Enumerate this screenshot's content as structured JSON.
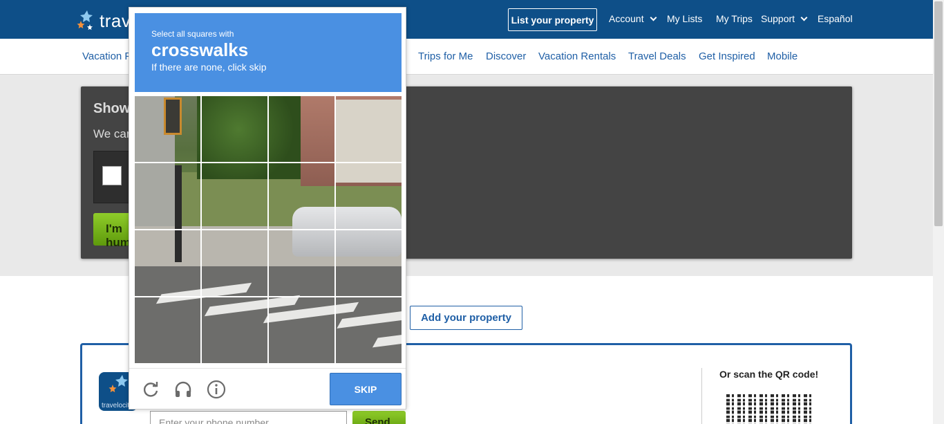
{
  "header": {
    "logo_text": "travelocity",
    "list_property": "List your property",
    "nav": [
      "Account",
      "My Lists",
      "My Trips",
      "Support",
      "Español"
    ]
  },
  "subnav": [
    "Vacation Packages",
    "Trips for Me",
    "Discover",
    "Vacation Rentals",
    "Travel Deals",
    "Get Inspired",
    "Mobile"
  ],
  "bot_check": {
    "title": "Show us your human side...",
    "subtitle": "We can't tell if you're a human or a bot.",
    "button": "I'm human"
  },
  "add_property": "Add your property",
  "app_promo": {
    "icon_label": "travelocity",
    "phone_placeholder": "Enter your phone number",
    "send": "Send",
    "qr_label": "Or scan the QR code!"
  },
  "captcha": {
    "instruction": "Select all squares with",
    "target": "crosswalks",
    "hint": "If there are none, click skip",
    "skip": "SKIP",
    "icons": [
      "refresh-icon",
      "headphones-icon",
      "info-icon"
    ],
    "accent": "#4a90e2"
  },
  "colors": {
    "brand_blue": "#0e4f88",
    "link_blue": "#1f5fa6",
    "green": "#6aa715"
  }
}
